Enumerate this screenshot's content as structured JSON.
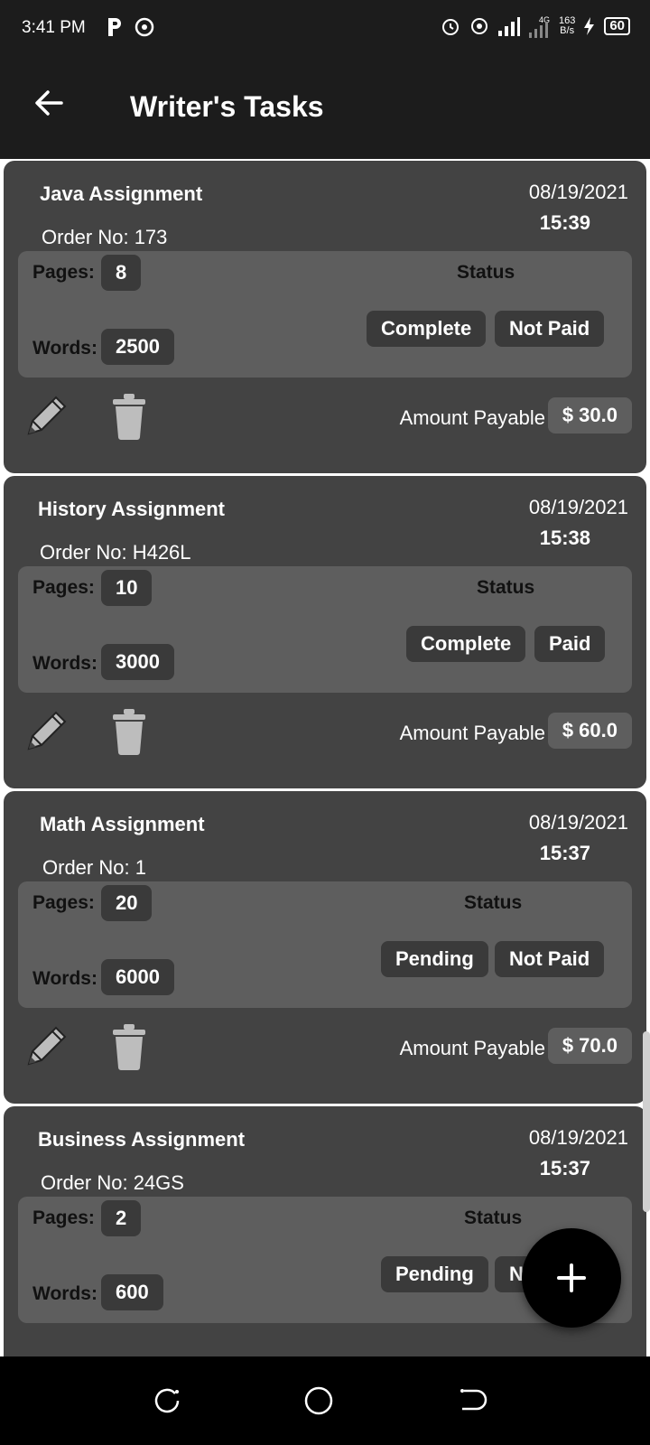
{
  "status_bar": {
    "time": "3:41 PM",
    "speed_top": "163",
    "speed_bottom": "B/s",
    "network": "4G",
    "battery": "60"
  },
  "app_bar": {
    "title": "Writer's Tasks"
  },
  "labels": {
    "pages": "Pages:",
    "words": "Words:",
    "status": "Status",
    "amount_payable": "Amount Payable"
  },
  "tasks": [
    {
      "subject": "Java Assignment",
      "order": "Order No: 173",
      "date": "08/19/2021",
      "time": "15:39",
      "pages": "8",
      "words": "2500",
      "progress": "Complete",
      "payment": "Not Paid",
      "amount": "$ 30.0"
    },
    {
      "subject": "History Assignment",
      "order": "Order No: H426L",
      "date": "08/19/2021",
      "time": "15:38",
      "pages": "10",
      "words": "3000",
      "progress": "Complete",
      "payment": "Paid",
      "amount": "$ 60.0"
    },
    {
      "subject": "Math Assignment",
      "order": "Order No: 1",
      "date": "08/19/2021",
      "time": "15:37",
      "pages": "20",
      "words": "6000",
      "progress": "Pending",
      "payment": "Not Paid",
      "amount": "$ 70.0"
    },
    {
      "subject": "Business Assignment",
      "order": "Order No: 24GS",
      "date": "08/19/2021",
      "time": "15:37",
      "pages": "2",
      "words": "600",
      "progress": "Pending",
      "payment": "Not Paid",
      "amount": ""
    }
  ],
  "icons": {
    "back": "arrow-left-icon",
    "edit": "pencil-icon",
    "delete": "trash-icon",
    "fab": "plus-icon"
  }
}
